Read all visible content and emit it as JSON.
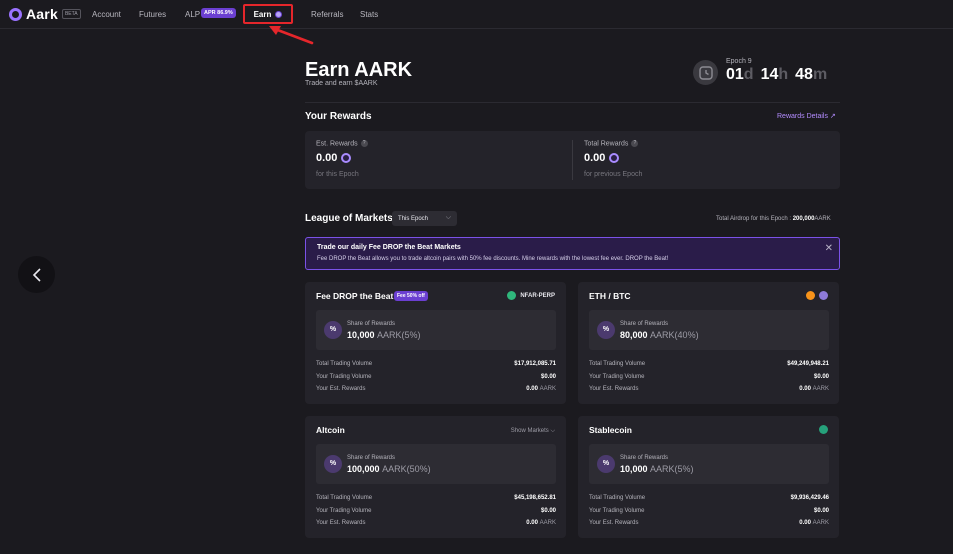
{
  "brand": {
    "name": "Aark",
    "tag": "BETA"
  },
  "nav": {
    "account": "Account",
    "futures": "Futures",
    "alp": "ALP",
    "alp_badge": "APR 86.9%",
    "earn": "Earn",
    "referrals": "Referrals",
    "stats": "Stats"
  },
  "header": {
    "title": "Earn AARK",
    "subtitle": "Trade and earn $AARK",
    "epoch_label": "Epoch 9",
    "countdown": {
      "days": "01",
      "d": "d",
      "hours": "14",
      "h": "h",
      "minutes": "48",
      "m": "m"
    }
  },
  "rewards": {
    "title": "Your Rewards",
    "details_link": "Rewards Details ↗",
    "est": {
      "label": "Est. Rewards",
      "value": "0.00",
      "foot": "for this Epoch"
    },
    "total": {
      "label": "Total Rewards",
      "value": "0.00",
      "foot": "for previous Epoch"
    }
  },
  "league": {
    "title": "League of Markets",
    "selector": "This Epoch",
    "airdrop_label": "Total Airdrop for this Epoch :",
    "airdrop_value": "200,000",
    "airdrop_unit": "AARK"
  },
  "banner": {
    "title": "Trade our daily Fee DROP the Beat Markets",
    "text": "Fee DROP the Beat allows you to trade altcoin pairs with 50% fee discounts. Mine rewards with the lowest fee ever. DROP the Beat!"
  },
  "labels": {
    "share": "Share of Rewards",
    "total_volume": "Total Trading Volume",
    "your_volume": "Your Trading Volume",
    "your_est": "Your Est. Rewards",
    "show_markets": "Show Markets ⌵"
  },
  "cards": [
    {
      "title": "Fee DROP the Beat",
      "badge": "Fee 50% off",
      "market": "NFAR-PERP",
      "share_value": "10,000",
      "share_unit": "AARK(5%)",
      "total_volume": "$17,912,085.71",
      "your_volume": "$0.00",
      "est_value": "0.00",
      "est_unit": "AARK"
    },
    {
      "title": "ETH / BTC",
      "share_value": "80,000",
      "share_unit": "AARK(40%)",
      "total_volume": "$49,249,948.21",
      "your_volume": "$0.00",
      "est_value": "0.00",
      "est_unit": "AARK"
    },
    {
      "title": "Altcoin",
      "share_value": "100,000",
      "share_unit": "AARK(50%)",
      "total_volume": "$45,198,652.81",
      "your_volume": "$0.00",
      "est_value": "0.00",
      "est_unit": "AARK"
    },
    {
      "title": "Stablecoin",
      "share_value": "10,000",
      "share_unit": "AARK(5%)",
      "total_volume": "$9,936,429.46",
      "your_volume": "$0.00",
      "est_value": "0.00",
      "est_unit": "AARK"
    }
  ],
  "colors": {
    "accent": "#7b52e8",
    "highlight_box": "#e5262b",
    "btc": "#f7931a",
    "eth": "#8e7ad8",
    "nfar": "#2fb67b",
    "usdt": "#26a17b"
  }
}
